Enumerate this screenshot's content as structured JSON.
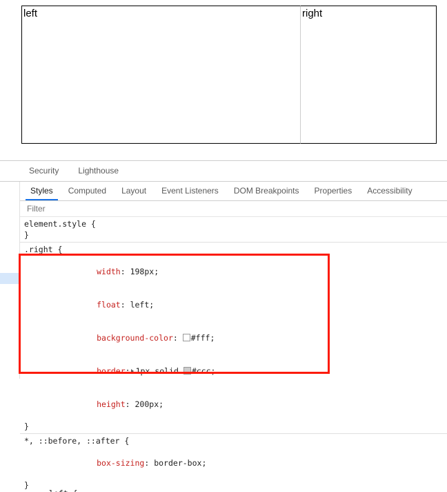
{
  "preview": {
    "left_box_label": "left",
    "right_box_label": "right"
  },
  "devtools": {
    "drawer_tabs": [
      {
        "label": "Security",
        "active": false
      },
      {
        "label": "Lighthouse",
        "active": false
      }
    ],
    "pane_tabs": [
      {
        "label": "Styles",
        "active": true
      },
      {
        "label": "Computed",
        "active": false
      },
      {
        "label": "Layout",
        "active": false
      },
      {
        "label": "Event Listeners",
        "active": false
      },
      {
        "label": "DOM Breakpoints",
        "active": false
      },
      {
        "label": "Properties",
        "active": false
      },
      {
        "label": "Accessibility",
        "active": false
      }
    ],
    "filter": {
      "placeholder": "Filter",
      "value": ""
    },
    "styles": {
      "rules": [
        {
          "selector": "element.style {",
          "close": "}",
          "declarations": []
        },
        {
          "selector": ".right {",
          "close": "}",
          "declarations": [
            {
              "property": "width",
              "value": "198px",
              "swatch": null,
              "expander": false
            },
            {
              "property": "float",
              "value": "left",
              "swatch": null,
              "expander": false
            },
            {
              "property": "background-color",
              "value": "#fff",
              "swatch": "#ffffff",
              "expander": false
            },
            {
              "property": "border",
              "value": "1px solid #ccc",
              "swatch": "#cccccc",
              "expander": true
            },
            {
              "property": "height",
              "value": "200px",
              "swatch": null,
              "expander": false
            }
          ]
        },
        {
          "selector": "*, ::before, ::after {",
          "close": "}",
          "declarations": [
            {
              "property": "box-sizing",
              "value": "border-box",
              "swatch": null,
              "expander": false
            }
          ]
        }
      ],
      "clipped_next_selector": ".left {"
    },
    "annotation": {
      "highlight_color": "#fc1b09"
    }
  }
}
